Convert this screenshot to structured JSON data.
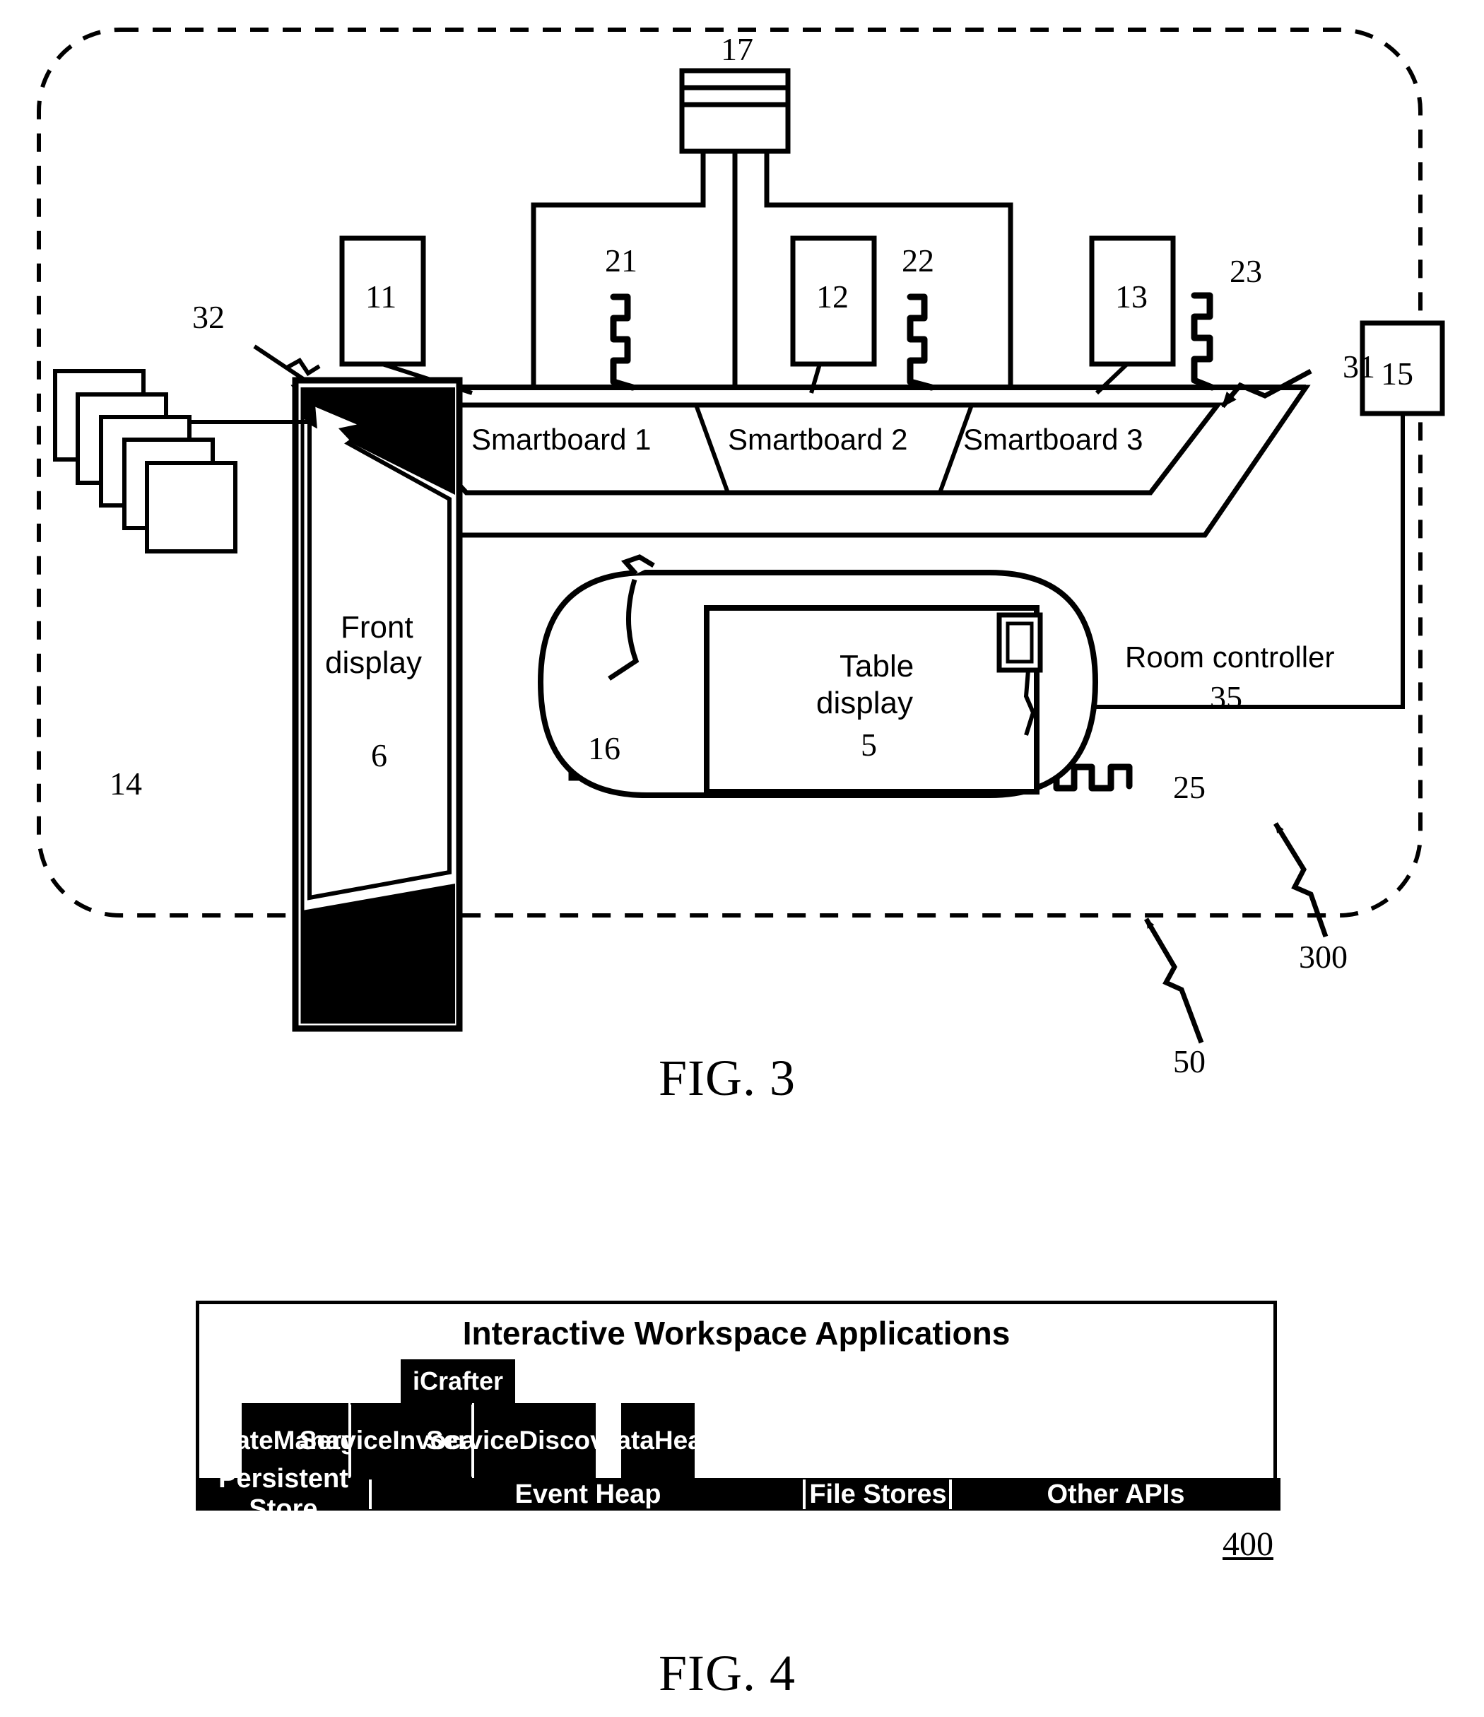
{
  "figure3": {
    "caption": "FIG. 3",
    "room_boundary_ref": "300",
    "system_ref": "50",
    "projector": {
      "ref": "17"
    },
    "computers": [
      {
        "ref": "11"
      },
      {
        "ref": "12"
      },
      {
        "ref": "13"
      },
      {
        "ref": "15"
      },
      {
        "ref": "16"
      }
    ],
    "wireless_links": [
      {
        "ref": "21"
      },
      {
        "ref": "22"
      },
      {
        "ref": "23"
      },
      {
        "ref": "25"
      }
    ],
    "smartboards": [
      {
        "label": "Smartboard 1"
      },
      {
        "label": "Smartboard 2"
      },
      {
        "label": "Smartboard 3"
      }
    ],
    "smartboard_group_ref": "31",
    "front_display": {
      "label_line1": "Front",
      "label_line2": "display",
      "ref": "6",
      "arrow_ref": "32",
      "windows_ref": "14"
    },
    "table": {
      "display_line1": "Table",
      "display_line2": "display",
      "ref": "5"
    },
    "room_controller": {
      "label": "Room controller",
      "ref": "35"
    }
  },
  "figure4": {
    "caption": "FIG. 4",
    "diagram_ref": "400",
    "title": "Interactive Workspace Applications",
    "icrafter": "iCrafter",
    "middle_row": [
      {
        "line1": "State",
        "line2": "Manager"
      },
      {
        "line1": "Service",
        "line2": "Invocation"
      },
      {
        "line1": "Service",
        "line2": "Discovery"
      },
      {
        "line1": "Data",
        "line2": "Heap"
      }
    ],
    "bottom_row": [
      {
        "label": "Persistent Store"
      },
      {
        "label": "Event Heap"
      },
      {
        "label": "File Stores"
      },
      {
        "label": "Other APIs"
      }
    ]
  },
  "colors": {
    "ink": "#000000",
    "paper": "#ffffff"
  }
}
